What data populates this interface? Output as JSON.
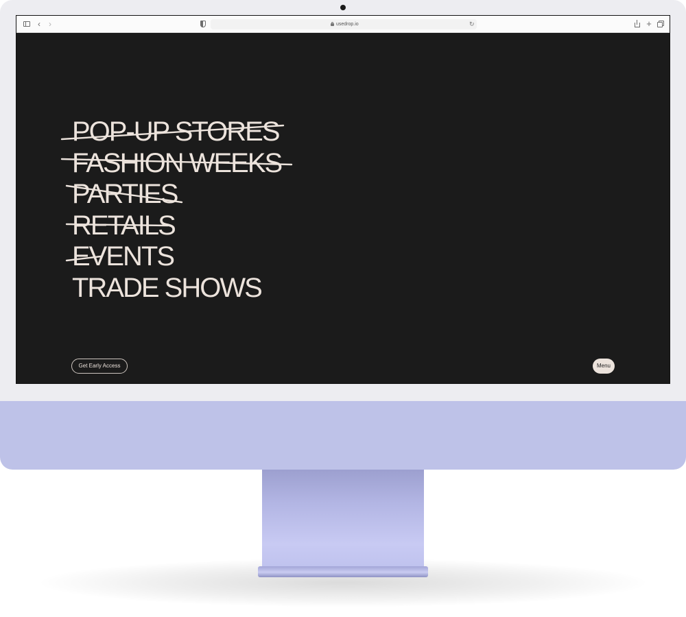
{
  "browser": {
    "url": "usedrop.io",
    "icons": [
      "sidebar-icon",
      "back-icon",
      "forward-icon",
      "shield-icon",
      "lock-icon",
      "reload-icon",
      "share-icon",
      "new-tab-icon",
      "tabs-overview-icon"
    ]
  },
  "hero": {
    "words": [
      {
        "label": "POP-UP STORES",
        "struck": true
      },
      {
        "label": "FASHION WEEKS",
        "struck": true
      },
      {
        "label": "PARTIES",
        "struck": true
      },
      {
        "label": "RETAILS",
        "struck": true
      },
      {
        "label": "EVENTS",
        "struck": true
      },
      {
        "label": "TRADE SHOWS",
        "struck": false
      }
    ]
  },
  "actions": {
    "cta_label": "Get Early Access",
    "menu_label": "Menu"
  },
  "colors": {
    "screen_background": "#1b1b1b",
    "text": "#ece3dc",
    "monitor_chin": "#bec2e8",
    "bezel": "#ededf1"
  }
}
